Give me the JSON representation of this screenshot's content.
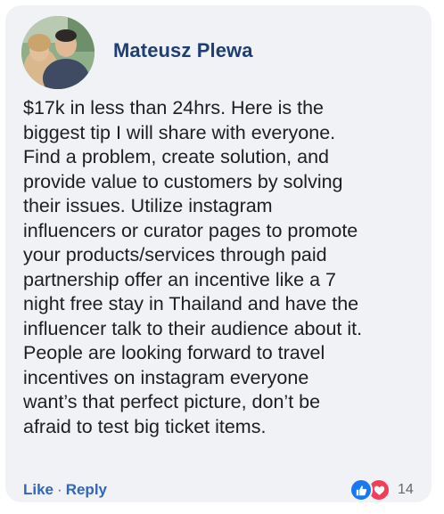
{
  "comment": {
    "author": "Mateusz Plewa",
    "lines": [
      "$17k in less than 24hrs. Here is the",
      "biggest tip I will share with everyone.",
      "Find a problem, create solution, and",
      "provide value to customers by solving",
      "their issues. Utilize instagram",
      "influencers or curator pages to promote",
      "your products/services through paid",
      "partnership offer an incentive like a 7",
      "night free stay in Thailand and have the",
      "influencer talk to their audience about it.",
      "People are looking forward to travel",
      "incentives on instagram everyone",
      "want’s that perfect picture, don’t be",
      "afraid to test big ticket items."
    ]
  },
  "actions": {
    "like_label": "Like",
    "separator": "·",
    "reply_label": "Reply"
  },
  "reactions": {
    "count": "14",
    "icons": [
      "like-icon",
      "love-icon"
    ],
    "like_color": "#1877f2",
    "love_color": "#f33e58"
  },
  "colors": {
    "author": "#1d3f73",
    "link": "#3465b8",
    "bubble": "#f0f2f5"
  }
}
